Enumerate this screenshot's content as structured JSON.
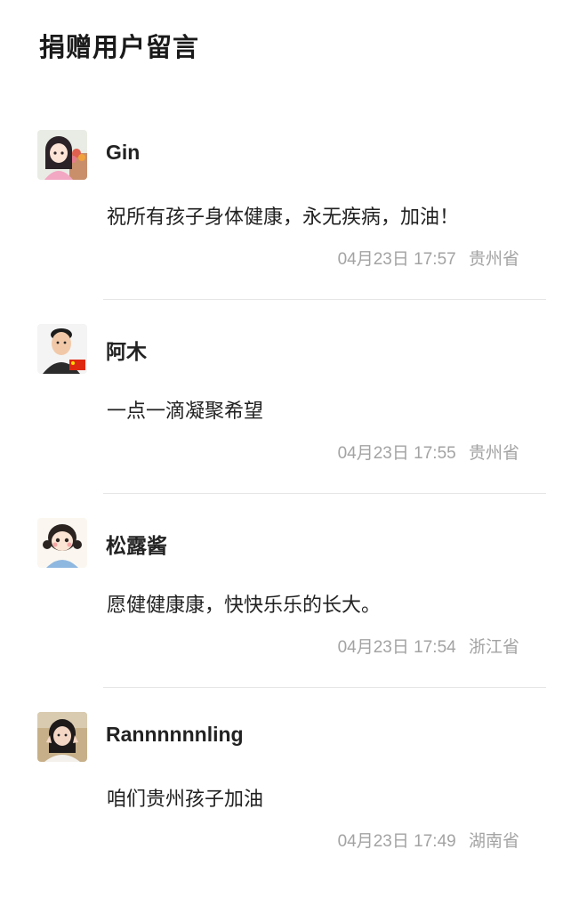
{
  "section": {
    "title": "捐赠用户留言"
  },
  "comments": [
    {
      "name": "Gin",
      "message": "祝所有孩子身体健康，永无疾病，加油！",
      "date": "04月23日",
      "time": "17:57",
      "region": "贵州省",
      "avatar": "girl-with-flowers-avatar"
    },
    {
      "name": "阿木",
      "message": "一点一滴凝聚希望",
      "date": "04月23日",
      "time": "17:55",
      "region": "贵州省",
      "avatar": "man-with-flag-avatar"
    },
    {
      "name": "松露酱",
      "message": "愿健健康康，快快乐乐的长大。",
      "date": "04月23日",
      "time": "17:54",
      "region": "浙江省",
      "avatar": "cartoon-girl-avatar"
    },
    {
      "name": "Rannnnnnling",
      "message": "咱们贵州孩子加油",
      "date": "04月23日",
      "time": "17:49",
      "region": "湖南省",
      "avatar": "girl-photo-avatar"
    }
  ]
}
